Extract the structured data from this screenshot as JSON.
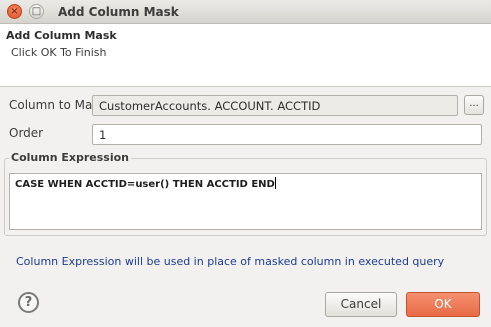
{
  "window": {
    "title": "Add Column Mask",
    "close_glyph": "×",
    "maximize_glyph": "□"
  },
  "banner": {
    "title": "Add Column Mask",
    "message": "Click OK To Finish"
  },
  "form": {
    "column_label": "Column to Mask",
    "column_value": "CustomerAccounts. ACCOUNT. ACCTID",
    "browse_label": "...",
    "order_label": "Order",
    "order_value": "1",
    "expression_group_label": "Column Expression",
    "expression_value": "CASE WHEN ACCTID=user() THEN ACCTID END"
  },
  "info_text": "Column Expression will be used in place of masked column in executed query",
  "footer": {
    "help_glyph": "?",
    "cancel_label": "Cancel",
    "ok_label": "OK"
  },
  "colors": {
    "primary_button": "#e86b45",
    "info_text": "#1c3c93"
  }
}
